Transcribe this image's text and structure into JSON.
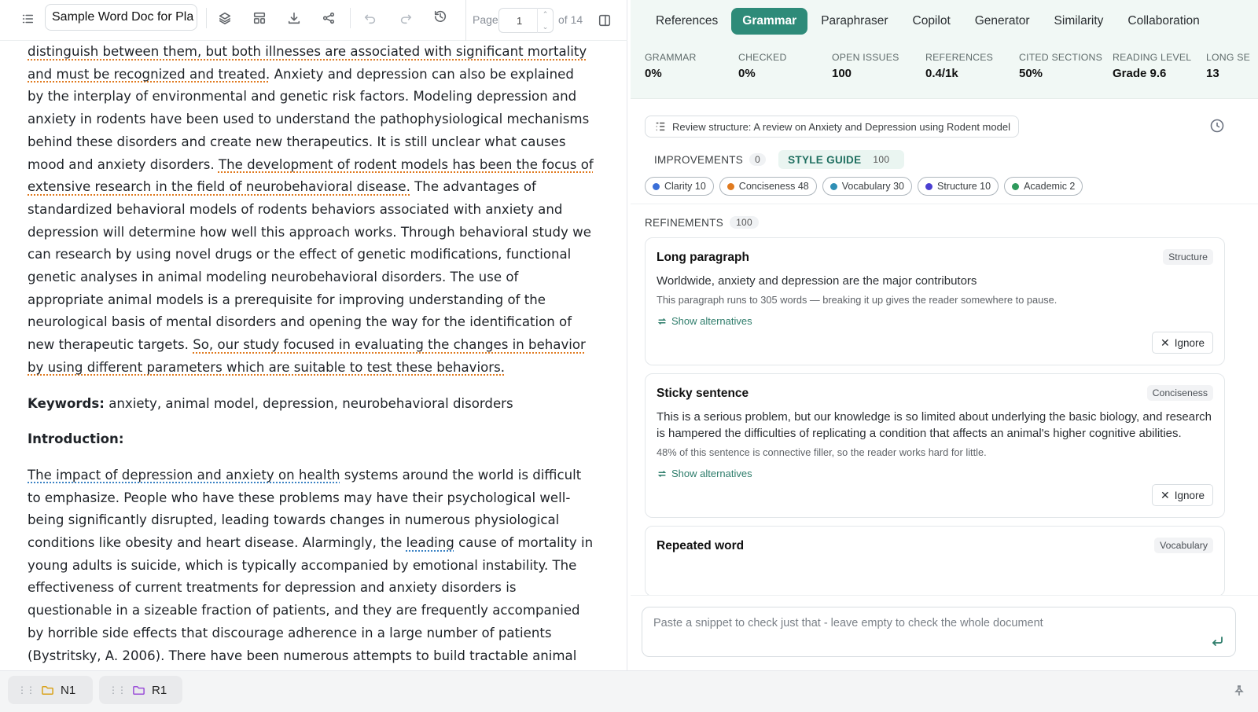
{
  "toolbar": {
    "doc_title": "Sample Word Doc for Pla",
    "page_label": "Page",
    "page_value": "1",
    "page_of": "of 14"
  },
  "document": {
    "para1_a": "distinguish between them, but both illnesses are associated with significant mortality and must be recognized and treated.",
    "para1_b": " Anxiety and depression can also be explained by the interplay of environmental and genetic risk factors. Modeling depression and anxiety in rodents have been used to understand the pathophysiological mechanisms behind these disorders and create new therapeutics. It is still unclear what causes mood and anxiety disorders. ",
    "para1_c": "The development of rodent models has been the focus of extensive research in the field of neurobehavioral disease.",
    "para1_d": " The advantages of standardized behavioral models of rodents behaviors associated with anxiety and depression will determine how well this approach works. Through behavioral study we can research by using novel drugs or the effect of genetic modifications, functional genetic analyses in animal modeling neurobehavioral disorders. The use of appropriate animal models is a prerequisite for improving understanding of the neurological basis of mental disorders and opening the way for the identification of new therapeutic targets. ",
    "para1_e": "So, our study focused in evaluating the changes in behavior by using different parameters which are suitable to test these behaviors.",
    "keywords_label": "Keywords:",
    "keywords_text": " anxiety, animal model, depression, neurobehavioral disorders",
    "intro_heading": "Introduction:",
    "para2_a": "The impact of depression and anxiety on health",
    "para2_b": " systems around the world is difficult to emphasize. People who have these problems may have their psychological well-being significantly disrupted, leading towards changes in numerous physiological conditions like obesity and heart disease. Alarmingly, the ",
    "para2_c": "leading",
    "para2_d": " cause of mortality in young adults is suicide, which is typically accompanied by emotional instability. The effectiveness of current treatments for depression and anxiety disorders is questionable in a sizeable fraction of patients, and they are frequently accompanied by horrible side effects that discourage adherence in a large number of patients (Bystritsky, A. 2006). There have been numerous attempts to build tractable animal models of human behavior as a result, the development"
  },
  "tabs": [
    "References",
    "Grammar",
    "Paraphraser",
    "Copilot",
    "Generator",
    "Similarity",
    "Collaboration"
  ],
  "active_tab": "Grammar",
  "stats": [
    {
      "label": "GRAMMAR",
      "value": "0%"
    },
    {
      "label": "CHECKED",
      "value": "0%"
    },
    {
      "label": "OPEN ISSUES",
      "value": "100"
    },
    {
      "label": "REFERENCES",
      "value": "0.4/1k"
    },
    {
      "label": "CITED SECTIONS",
      "value": "50%"
    },
    {
      "label": "READING LEVEL",
      "value": "Grade 9.6"
    },
    {
      "label": "LONG SE",
      "value": "13"
    }
  ],
  "review_chip": "Review structure: A review on Anxiety and Depression using Rodent model",
  "guide_tabs": [
    {
      "label": "IMPROVEMENTS",
      "count": "0"
    },
    {
      "label": "STYLE GUIDE",
      "count": "100"
    }
  ],
  "categories": [
    {
      "label": "Clarity 10",
      "color": "#3b6fd8"
    },
    {
      "label": "Conciseness 48",
      "color": "#e07a1f"
    },
    {
      "label": "Vocabulary 30",
      "color": "#2f8fb5"
    },
    {
      "label": "Structure 10",
      "color": "#4b3fd1"
    },
    {
      "label": "Academic 2",
      "color": "#2e9a5c"
    }
  ],
  "refinements": {
    "label": "REFINEMENTS",
    "count": "100"
  },
  "cards": [
    {
      "title": "Long paragraph",
      "tag": "Structure",
      "text": "Worldwide, anxiety and depression are the major contributors",
      "note": "This paragraph runs to 305 words — breaking it up gives the reader somewhere to pause.",
      "alt": "Show alternatives",
      "ignore": "Ignore"
    },
    {
      "title": "Sticky sentence",
      "tag": "Conciseness",
      "text": "This is a serious problem, but our knowledge is so limited about underlying the basic biology, and research is hampered the difficulties of replicating a condition that affects an animal's higher cognitive abilities.",
      "note": "48% of this sentence is connective filler, so the reader works hard for little.",
      "alt": "Show alternatives",
      "ignore": "Ignore"
    },
    {
      "title": "Repeated word",
      "tag": "Vocabulary"
    }
  ],
  "snippet_placeholder": "Paste a snippet to check just that - leave empty to check the whole document",
  "folders": [
    {
      "label": "N1",
      "color": "#d9a21b"
    },
    {
      "label": "R1",
      "color": "#9b4fd8"
    }
  ]
}
